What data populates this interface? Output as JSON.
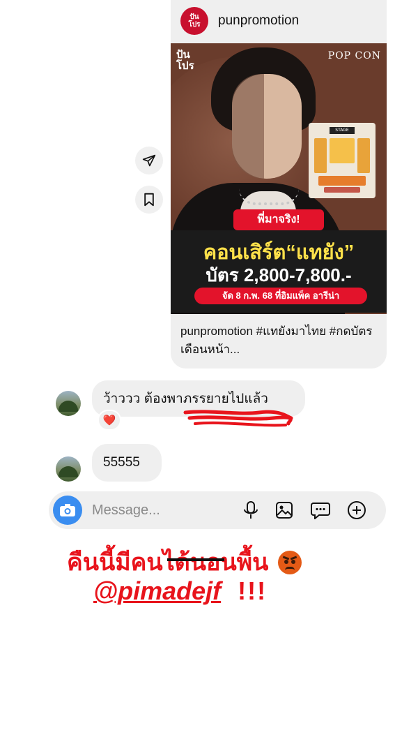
{
  "shared_post": {
    "account_name": "punpromotion",
    "avatar_text": "ปัน\nโปร",
    "poster": {
      "brand_left": "ปัน\nโปร",
      "brand_right": "POP CON",
      "seatmap_stage": "STAGE",
      "tagline": "พี่มาจริง!",
      "headline": "คอนเสิร์ต“แทยัง”",
      "price": "บัตร 2,800-7,800.-",
      "date_venue": "จัด 8 ก.พ. 68 ที่อิมแพ็ค อารีน่า"
    },
    "caption": "punpromotion #แทยังมาไทย #กดบัตรเดือนหน้า..."
  },
  "side_actions": {
    "share_icon": "paper-plane-icon",
    "save_icon": "bookmark-icon"
  },
  "messages": [
    {
      "text": "ว้าววว ต้องพาภรรยายไปแล้ว",
      "reaction": "❤️"
    },
    {
      "text": "55555"
    }
  ],
  "composer": {
    "placeholder": "Message...",
    "icons": [
      "camera-icon",
      "microphone-icon",
      "gallery-icon",
      "sticker-icon",
      "plus-icon"
    ]
  },
  "story_overlay": {
    "line1": "คืนนี้มีคนได้นอนพื้น",
    "emoji": "😡",
    "mention": "@pimadejf",
    "exclaim": "!!!"
  },
  "colors": {
    "brand_red": "#c8102e",
    "overlay_red": "#e8141c",
    "bubble_gray": "#efefef",
    "accent_blue": "#3a8df0",
    "poster_bg": "#6a3c2c",
    "headline_yellow": "#ffe14a"
  }
}
